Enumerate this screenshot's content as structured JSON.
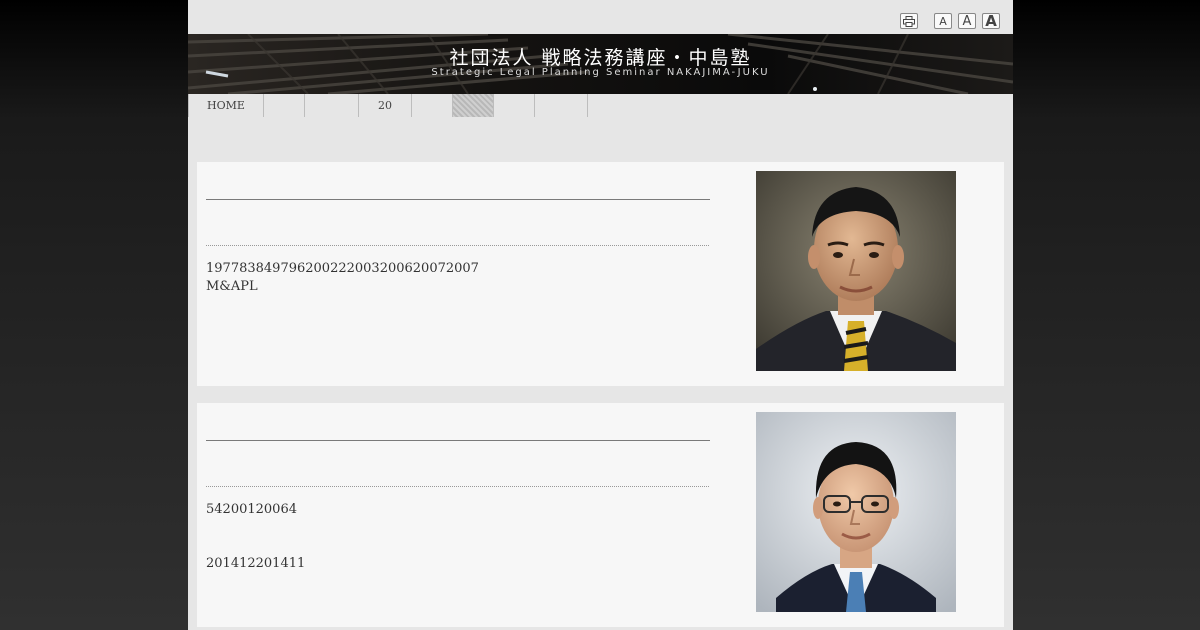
{
  "header": {
    "title": "社団法人 戦略法務講座・中島塾",
    "subtitle": "Strategic Legal Planning Seminar NAKAJIMA-JUKU"
  },
  "utility": {
    "font_small": "A",
    "font_medium": "A",
    "font_large": "A"
  },
  "nav": {
    "items": [
      {
        "label": "HOME"
      },
      {
        "label": ""
      },
      {
        "label": ""
      },
      {
        "label": "20"
      },
      {
        "label": ""
      },
      {
        "label": ""
      },
      {
        "label": ""
      },
      {
        "label": ""
      }
    ],
    "active_index": 5
  },
  "profiles": [
    {
      "lines": [
        "19778384979620022200320062007​2007",
        "M&APL"
      ]
    },
    {
      "lines": [
        "54200120064",
        "201412201411"
      ]
    }
  ],
  "colors": {
    "page_bg": "#e6e6e6",
    "card_bg": "#f7f7f7",
    "banner_bg": "#0d0d0d"
  }
}
